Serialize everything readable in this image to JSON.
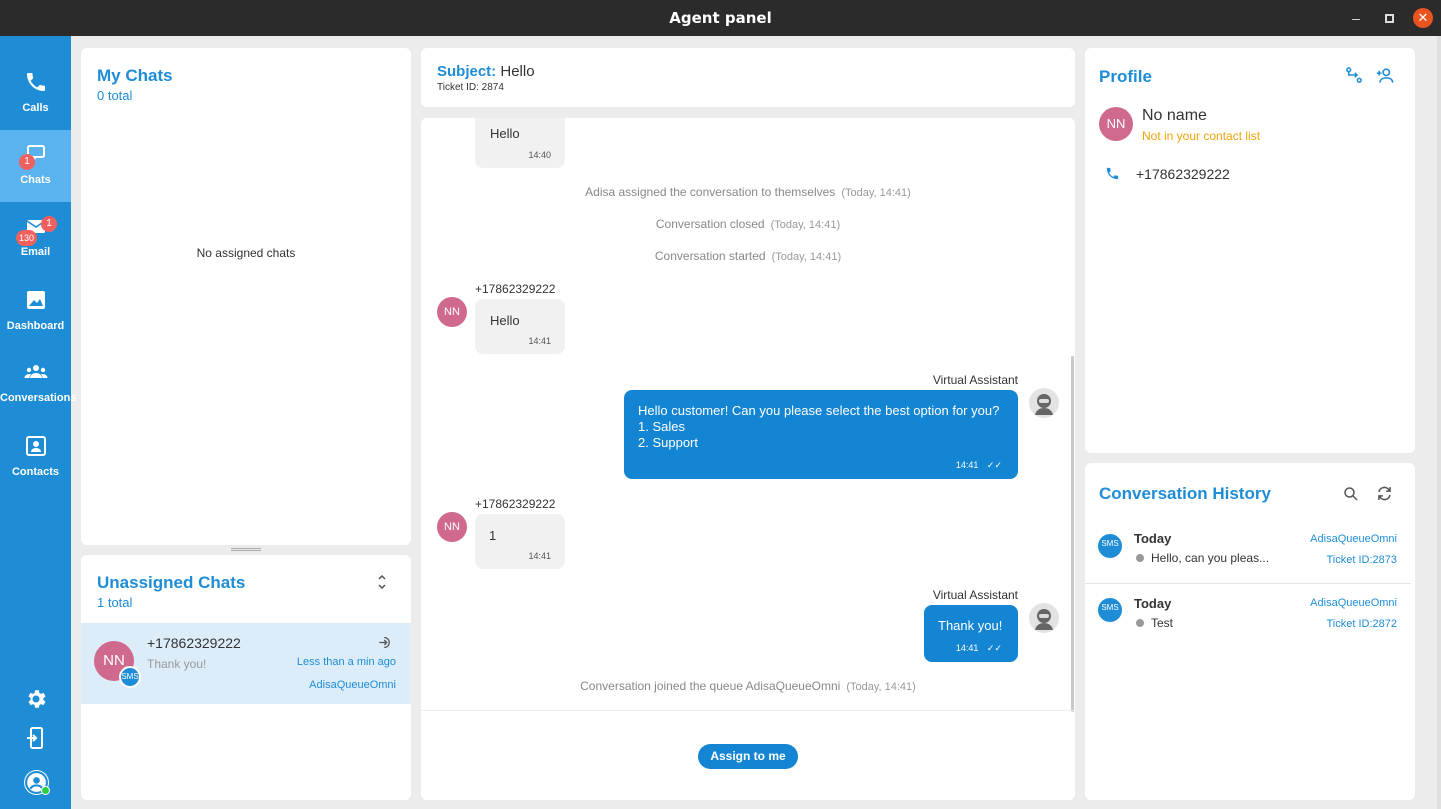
{
  "window": {
    "title": "Agent panel"
  },
  "sidebar": {
    "items": [
      {
        "label": "Calls",
        "icon": "phone-icon"
      },
      {
        "label": "Chats",
        "icon": "chat-icon",
        "badge": "1"
      },
      {
        "label": "Email",
        "icon": "mail-icon",
        "badge": "1",
        "count": "130"
      },
      {
        "label": "Dashboard",
        "icon": "image-icon"
      },
      {
        "label": "Conversations",
        "icon": "group-icon"
      },
      {
        "label": "Contacts",
        "icon": "contact-card-icon"
      }
    ]
  },
  "my_chats": {
    "title": "My Chats",
    "total": "0 total",
    "empty_text": "No assigned chats"
  },
  "unassigned": {
    "title": "Unassigned Chats",
    "total": "1 total",
    "item": {
      "initials": "NN",
      "channel": "SMS",
      "phone": "+17862329222",
      "preview": "Thank you!",
      "time": "Less than a min ago",
      "queue": "AdisaQueueOmni"
    }
  },
  "conversation": {
    "subject_label": "Subject:",
    "subject": "Hello",
    "ticket": "Ticket ID: 2874",
    "msg0": {
      "text": "Hello",
      "time": "14:40"
    },
    "sys1": {
      "text": "Adisa assigned the conversation to themselves",
      "ts": "(Today, 14:41)"
    },
    "sys2": {
      "text": "Conversation closed",
      "ts": "(Today, 14:41)"
    },
    "sys3": {
      "text": "Conversation started",
      "ts": "(Today, 14:41)"
    },
    "msg1": {
      "sender": "+17862329222",
      "initials": "NN",
      "text": "Hello",
      "time": "14:41"
    },
    "msg2": {
      "sender": "Virtual Assistant",
      "text": "Hello customer! Can you please select the best option for you?\n1. Sales\n2. Support",
      "time": "14:41"
    },
    "msg3": {
      "sender": "+17862329222",
      "initials": "NN",
      "text": "1",
      "time": "14:41"
    },
    "msg4": {
      "sender": "Virtual Assistant",
      "text": "Thank you!",
      "time": "14:41"
    },
    "sys4": {
      "text": "Conversation joined the queue AdisaQueueOmni",
      "ts": "(Today, 14:41)"
    },
    "assign_label": "Assign to me"
  },
  "profile": {
    "title": "Profile",
    "initials": "NN",
    "name": "No name",
    "contact_status": "Not in your contact list",
    "phone": "+17862329222"
  },
  "history": {
    "title": "Conversation History",
    "items": [
      {
        "channel": "SMS",
        "day": "Today",
        "preview": "Hello, can you pleas...",
        "queue": "AdisaQueueOmni",
        "ticket": "Ticket ID:2873"
      },
      {
        "channel": "SMS",
        "day": "Today",
        "preview": "Test",
        "queue": "AdisaQueueOmni",
        "ticket": "Ticket ID:2872"
      }
    ]
  },
  "colors": {
    "accent": "#1e8dd6",
    "bubble_out": "#1385d2",
    "avatar": "#cf6a8e",
    "warning": "#f0a30a",
    "badge": "#f0605f"
  }
}
